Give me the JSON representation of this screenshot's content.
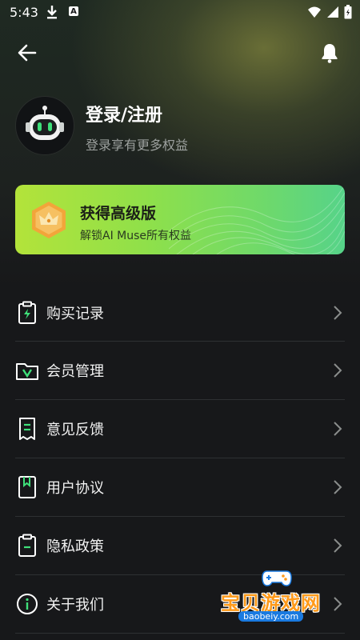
{
  "status_bar": {
    "time": "5:43",
    "notification_badge": "A"
  },
  "header": {
    "back_icon": "arrow-left-icon",
    "bell_icon": "bell-icon"
  },
  "profile": {
    "title": "登录/注册",
    "subtitle": "登录享有更多权益",
    "avatar_icon": "robot-avatar-icon"
  },
  "premium": {
    "title": "获得高级版",
    "subtitle": "解锁AI Muse所有权益",
    "badge_icon": "crown-hexagon-icon",
    "accent_colors": [
      "#b3e33a",
      "#56d389"
    ]
  },
  "menu": {
    "items": [
      {
        "label": "购买记录",
        "icon": "receipt-bolt-icon"
      },
      {
        "label": "会员管理",
        "icon": "vip-folder-icon"
      },
      {
        "label": "意见反馈",
        "icon": "feedback-document-icon"
      },
      {
        "label": "用户协议",
        "icon": "bookmark-document-icon"
      },
      {
        "label": "隐私政策",
        "icon": "clipboard-icon"
      },
      {
        "label": "关于我们",
        "icon": "info-circle-icon"
      }
    ]
  },
  "watermark": {
    "title": "宝贝游戏网",
    "url": "baobeiy.com"
  }
}
